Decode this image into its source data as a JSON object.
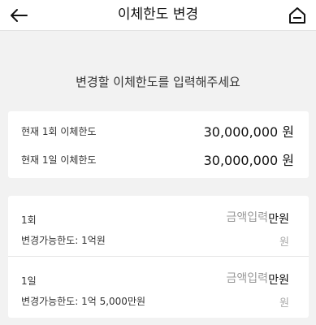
{
  "header": {
    "title": "이체한도 변경",
    "back_icon": "arrow-left-icon",
    "home_icon": "home-icon"
  },
  "instruction": "변경할 이체한도를 입력해주세요",
  "current_limits": [
    {
      "label": "현재 1회 이체한도",
      "value": "30,000,000 원"
    },
    {
      "label": "현재 1일 이체한도",
      "value": "30,000,000 원"
    }
  ],
  "edit_rows": [
    {
      "period": "1회",
      "available": "변경가능한도: 1억원",
      "placeholder": "금액입력",
      "unit_man": "만원",
      "unit_won": "원"
    },
    {
      "period": "1일",
      "available": "변경가능한도: 1억 5,000만원",
      "placeholder": "금액입력",
      "unit_man": "만원",
      "unit_won": "원"
    }
  ],
  "colors": {
    "background": "#f2f2f2",
    "card": "#ffffff",
    "placeholder": "#9a9a9a",
    "muted_unit": "#aaaaaa"
  }
}
